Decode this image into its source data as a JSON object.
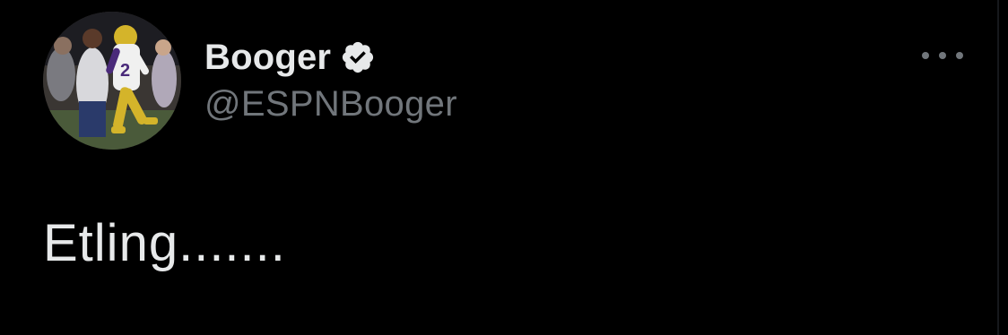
{
  "tweet": {
    "author": {
      "display_name": "Booger",
      "handle": "@ESPNBooger",
      "verified": true,
      "avatar_icon": "football-player-avatar"
    },
    "text": "Etling.......",
    "more_icon": "ellipsis-icon"
  },
  "colors": {
    "background": "#000000",
    "primary_text": "#e7e9ea",
    "secondary_text": "#71767b",
    "verified_badge": "#e7e9ea"
  }
}
